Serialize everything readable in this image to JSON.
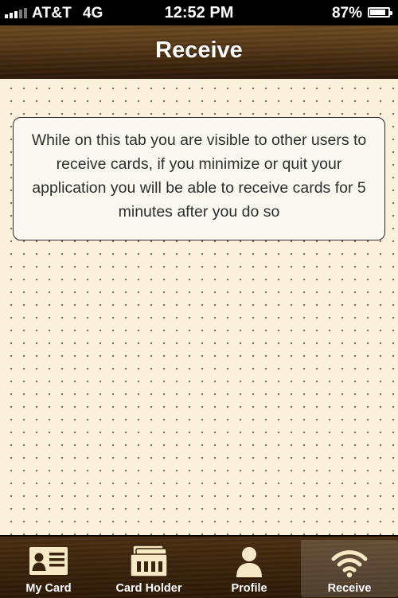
{
  "status_bar": {
    "carrier": "AT&T",
    "network": "4G",
    "time": "12:52 PM",
    "battery_percent": "87%",
    "battery_level": 0.87,
    "signal_bars": 3,
    "signal_max": 5
  },
  "nav": {
    "title": "Receive"
  },
  "content": {
    "message": "While on this tab you are visible to other users to receive cards, if you minimize or quit your application you will be able to receive cards for 5 minutes after you do so"
  },
  "tabs": [
    {
      "label": "My Card",
      "icon": "id-card-icon",
      "selected": false
    },
    {
      "label": "Card Holder",
      "icon": "card-holder-icon",
      "selected": false
    },
    {
      "label": "Profile",
      "icon": "person-icon",
      "selected": false
    },
    {
      "label": "Receive",
      "icon": "wifi-icon",
      "selected": true
    }
  ],
  "colors": {
    "nav_brown": "#5a3a18",
    "tab_brown": "#3a230c",
    "paper": "#fbf0db",
    "icon_cream": "#f7e8c6"
  }
}
